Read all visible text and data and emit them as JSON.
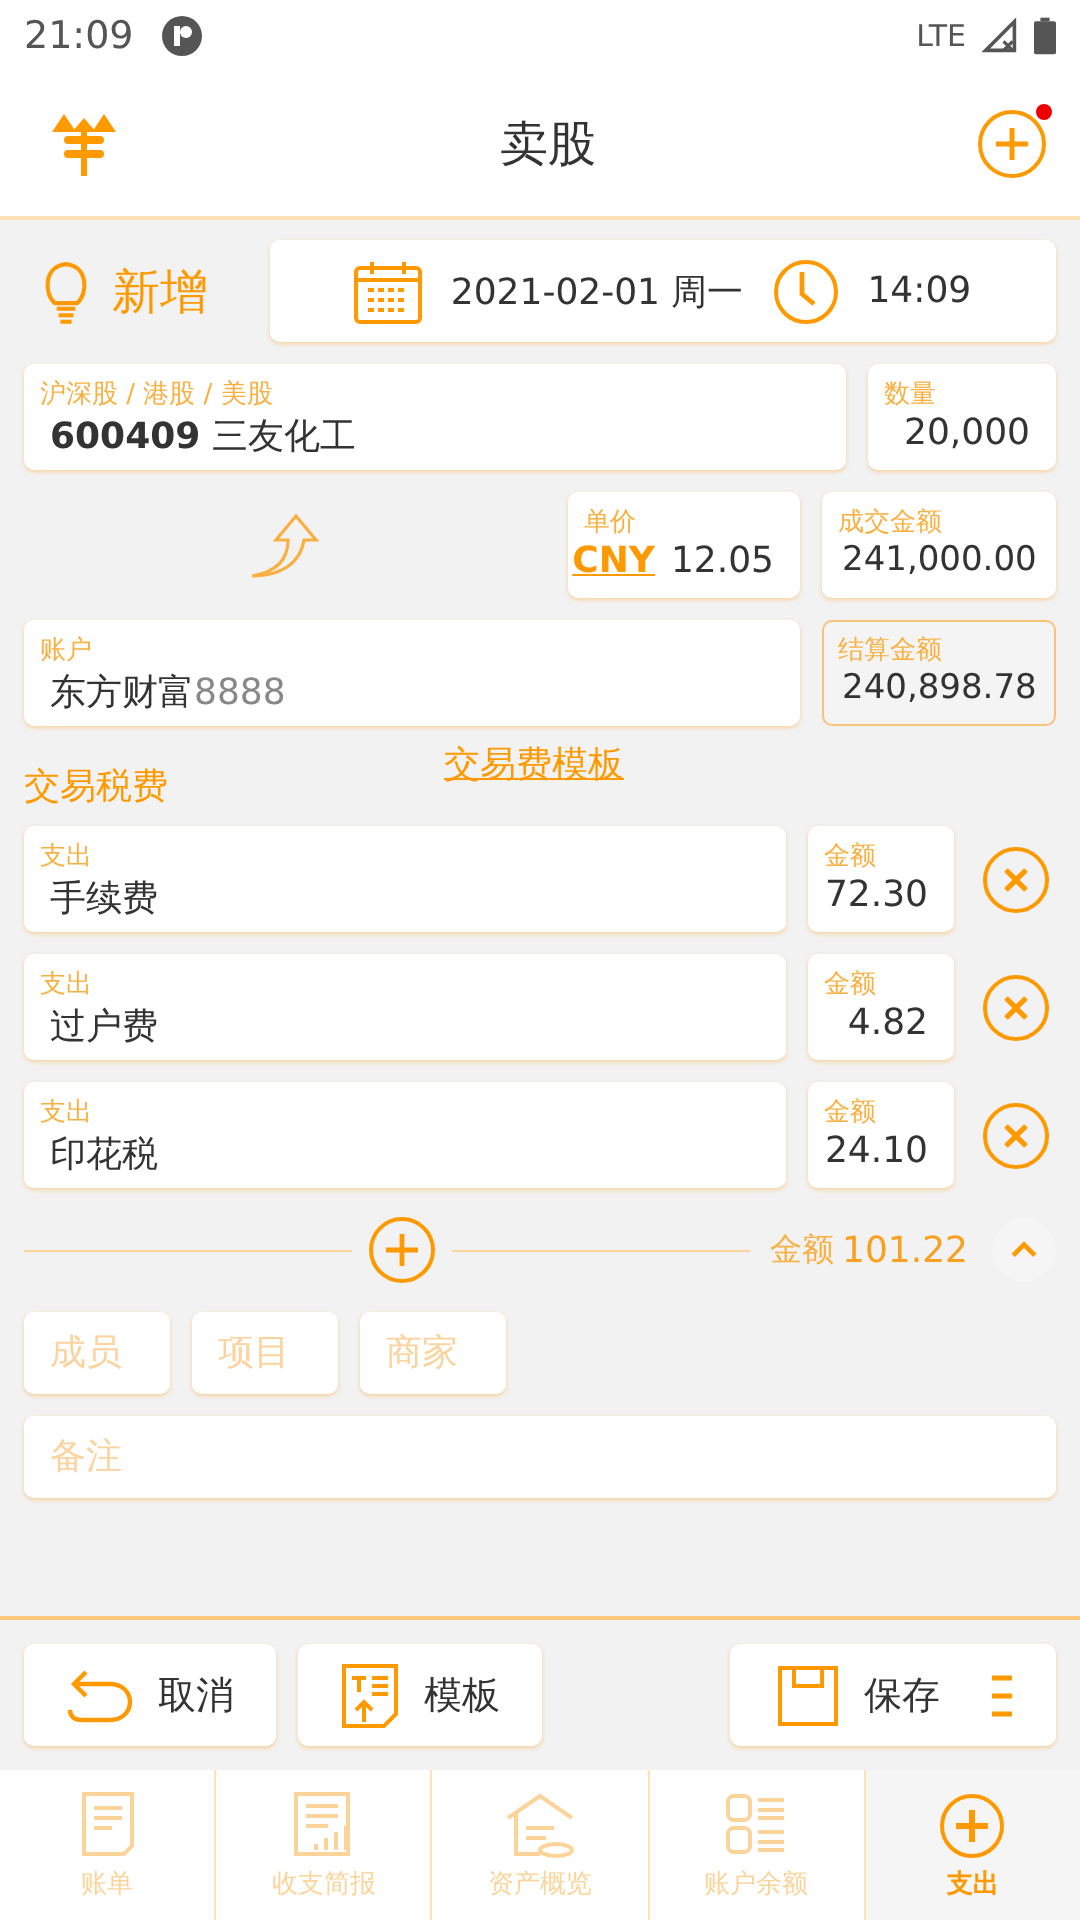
{
  "status_bar": {
    "time": "21:09",
    "network": "LTE"
  },
  "header": {
    "title": "卖股",
    "notification": true
  },
  "entry": {
    "mode": "新增",
    "date": "2021-02-01 周一",
    "time": "14:09"
  },
  "stock": {
    "label": "沪深股 / 港股 / 美股",
    "value": "**600409** 三友化工"
  },
  "quantity": {
    "label": "数量",
    "value": "20,000"
  },
  "price": {
    "label": "单价",
    "currency": "CNY",
    "value": "12.05"
  },
  "deal_amount": {
    "label": "成交金额",
    "value": "241,000.00"
  },
  "account": {
    "label": "账户",
    "name": "东方财富",
    "number": "8888"
  },
  "settlement": {
    "label": "结算金额",
    "value": "240,898.78"
  },
  "fees_section": {
    "title": "交易税费",
    "template_link": "交易费模板"
  },
  "fees": [
    {
      "label": "支出",
      "name": "手续费",
      "amount_label": "金额",
      "amount": "72.30"
    },
    {
      "label": "支出",
      "name": "过户费",
      "amount_label": "金额",
      "amount": "4.82"
    },
    {
      "label": "支出",
      "name": "印花税",
      "amount_label": "金额",
      "amount": "24.10"
    }
  ],
  "fee_total": {
    "label": "金额",
    "value": "101.22",
    "expanded": true
  },
  "tags": [
    {
      "placeholder": "成员"
    },
    {
      "placeholder": "项目"
    },
    {
      "placeholder": "商家"
    }
  ],
  "note": {
    "placeholder": "备注"
  },
  "actions": [
    {
      "kind": "cancel",
      "label": "取消"
    },
    {
      "kind": "template",
      "label": "模板"
    },
    {
      "kind": "save",
      "label": "保存"
    }
  ],
  "tabs": [
    {
      "kind": "bill",
      "label": "账单",
      "selected": false
    },
    {
      "kind": "report",
      "label": "收支简报",
      "selected": false
    },
    {
      "kind": "assets",
      "label": "资产概览",
      "selected": false
    },
    {
      "kind": "balance",
      "label": "账户余额",
      "selected": false
    },
    {
      "kind": "expense",
      "label": "支出",
      "selected": true
    }
  ]
}
